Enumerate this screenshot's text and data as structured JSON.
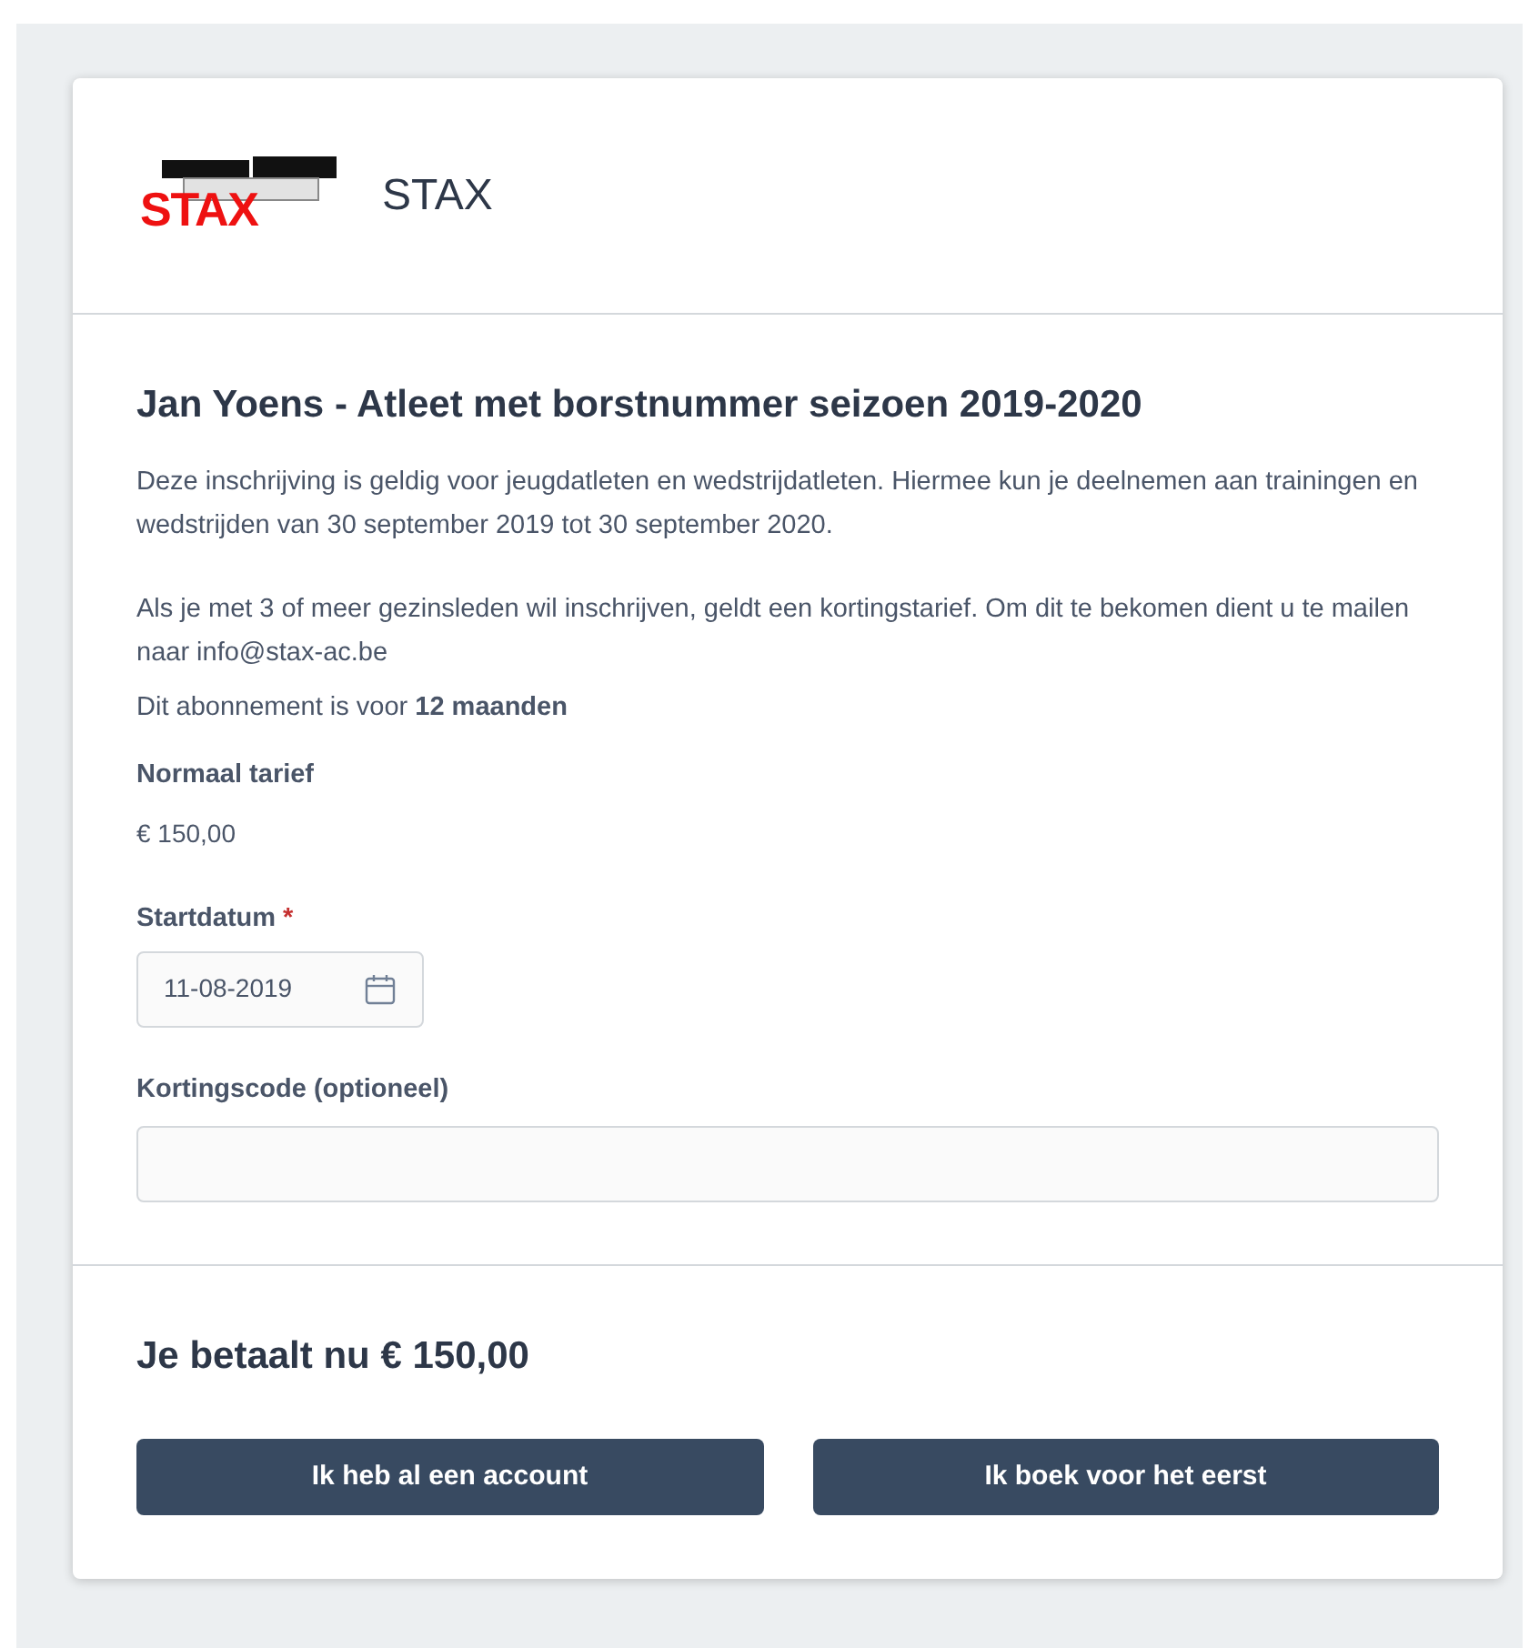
{
  "header": {
    "logo_text": "STAX",
    "title": "STAX"
  },
  "form": {
    "title": "Jan Yoens - Atleet met borstnummer seizoen 2019-2020",
    "paragraphs": [
      "Deze inschrijving is geldig voor jeugdatleten en wedstrijdatleten. Hiermee kun je deelnemen aan trainingen en wedstrijden van 30 september 2019 tot 30 september 2020.",
      "Als je met 3 of meer gezinsleden wil inschrijven, geldt een kortingstarief. Om dit te bekomen dient u te mailen naar info@stax-ac.be"
    ],
    "duration": "Dit abonnement is voor **12 maanden**",
    "price_label": "Normaal tarief",
    "price": "€ 150,00",
    "start_date": {
      "label": "Startdatum",
      "required_mark": "*",
      "value": "11-08-2019"
    },
    "discount_code": {
      "label": "Kortingscode (optioneel)"
    }
  },
  "footer": {
    "total": "Je betaalt nu € 150,00",
    "buttons": [
      "Ik heb al een account",
      "Ik boek voor het eerst"
    ]
  }
}
